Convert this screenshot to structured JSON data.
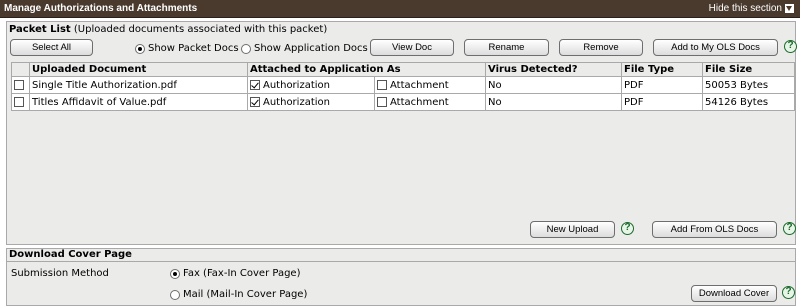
{
  "header": {
    "title": "Manage Authorizations and Attachments",
    "hide_label": "Hide this section"
  },
  "packet": {
    "title_bold": "Packet List",
    "title_rest": " (Uploaded documents associated with this packet)"
  },
  "toolbar": {
    "select_all": "Select All",
    "show_packet_docs": "Show Packet Docs",
    "show_application_docs": "Show Application Docs",
    "view_doc": "View Doc",
    "rename": "Rename",
    "remove": "Remove",
    "add_to_ols": "Add to My OLS Docs"
  },
  "help_glyph": "?",
  "table": {
    "headers": [
      "Uploaded Document",
      "Attached to Application As",
      "Virus Detected?",
      "File Type",
      "File Size"
    ],
    "rows": [
      {
        "name": "Single Title Authorization.pdf",
        "authorization": "Authorization",
        "attachment": "Attachment",
        "virus": "No",
        "type": "PDF",
        "size": "50053 Bytes"
      },
      {
        "name": "Titles Affidavit of Value.pdf",
        "authorization": "Authorization",
        "attachment": "Attachment",
        "virus": "No",
        "type": "PDF",
        "size": "54126 Bytes"
      }
    ]
  },
  "actions": {
    "new_upload": "New Upload",
    "add_from_ols": "Add From OLS Docs"
  },
  "cover": {
    "title": "Download Cover Page",
    "submission_label": "Submission Method",
    "fax": "Fax (Fax-In Cover Page)",
    "mail": "Mail (Mail-In Cover Page)",
    "download": "Download Cover"
  }
}
